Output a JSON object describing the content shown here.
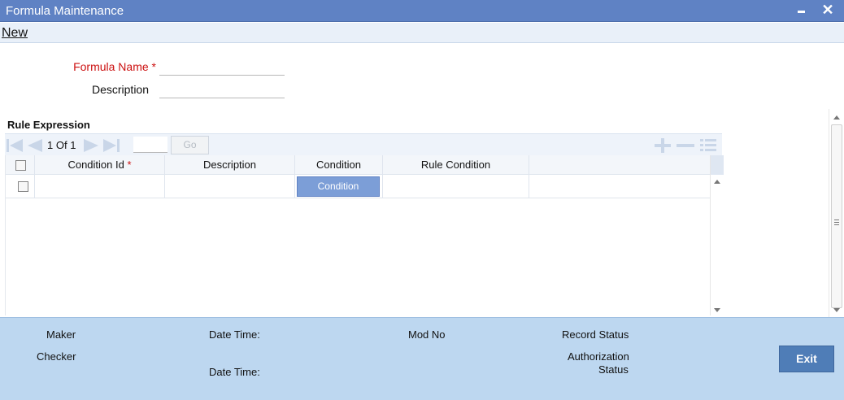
{
  "window": {
    "title": "Formula Maintenance"
  },
  "menu": {
    "new_label": "New"
  },
  "form": {
    "formula_name_label": "Formula Name",
    "description_label": "Description",
    "formula_name_value": "",
    "description_value": ""
  },
  "rule_expression": {
    "title": "Rule Expression",
    "pager": {
      "current": "1",
      "of_label": "Of",
      "total": "1",
      "go_label": "Go"
    },
    "columns": [
      {
        "label": "Condition Id"
      },
      {
        "label": "Description"
      },
      {
        "label": "Condition"
      },
      {
        "label": "Rule Condition"
      }
    ],
    "rows": [
      {
        "condition_id": "",
        "description": "",
        "condition_button": "Condition",
        "rule_condition": ""
      }
    ]
  },
  "footer": {
    "maker_label": "Maker",
    "checker_label": "Checker",
    "date_time_label": "Date Time:",
    "mod_no_label": "Mod No",
    "record_status_label": "Record Status",
    "authorization_status_line1": "Authorization",
    "authorization_status_line2": "Status",
    "exit_label": "Exit"
  },
  "colors": {
    "titlebar": "#5f82c4",
    "footer": "#bdd7f0",
    "required": "#cc1111",
    "condition_button": "#7c9ed7",
    "exit_button": "#4f7db7"
  },
  "icons": {
    "first_page": "first-page-icon",
    "previous_page": "previous-page-icon",
    "next_page": "next-page-icon",
    "last_page": "last-page-icon",
    "add_row": "add-row-icon",
    "delete_row": "delete-row-icon",
    "single_view": "single-view-icon"
  }
}
